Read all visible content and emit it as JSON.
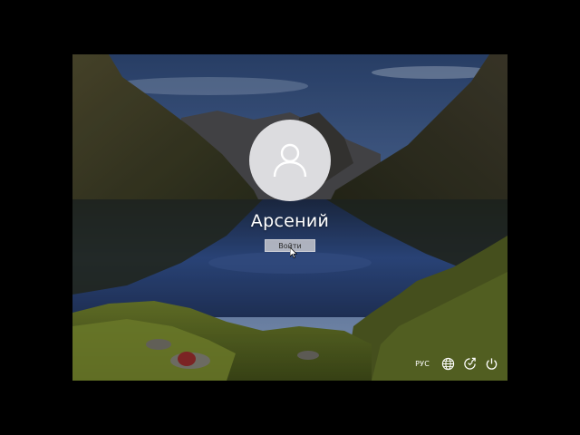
{
  "login": {
    "username": "Арсений",
    "signin_label": "Войти"
  },
  "tray": {
    "language": "РУС",
    "icons": [
      "network-icon",
      "accessibility-icon",
      "power-icon"
    ]
  },
  "colors": {
    "avatar_bg": "#dcdcdf",
    "button_bg": "#cdcdd2",
    "text": "#ffffff"
  }
}
